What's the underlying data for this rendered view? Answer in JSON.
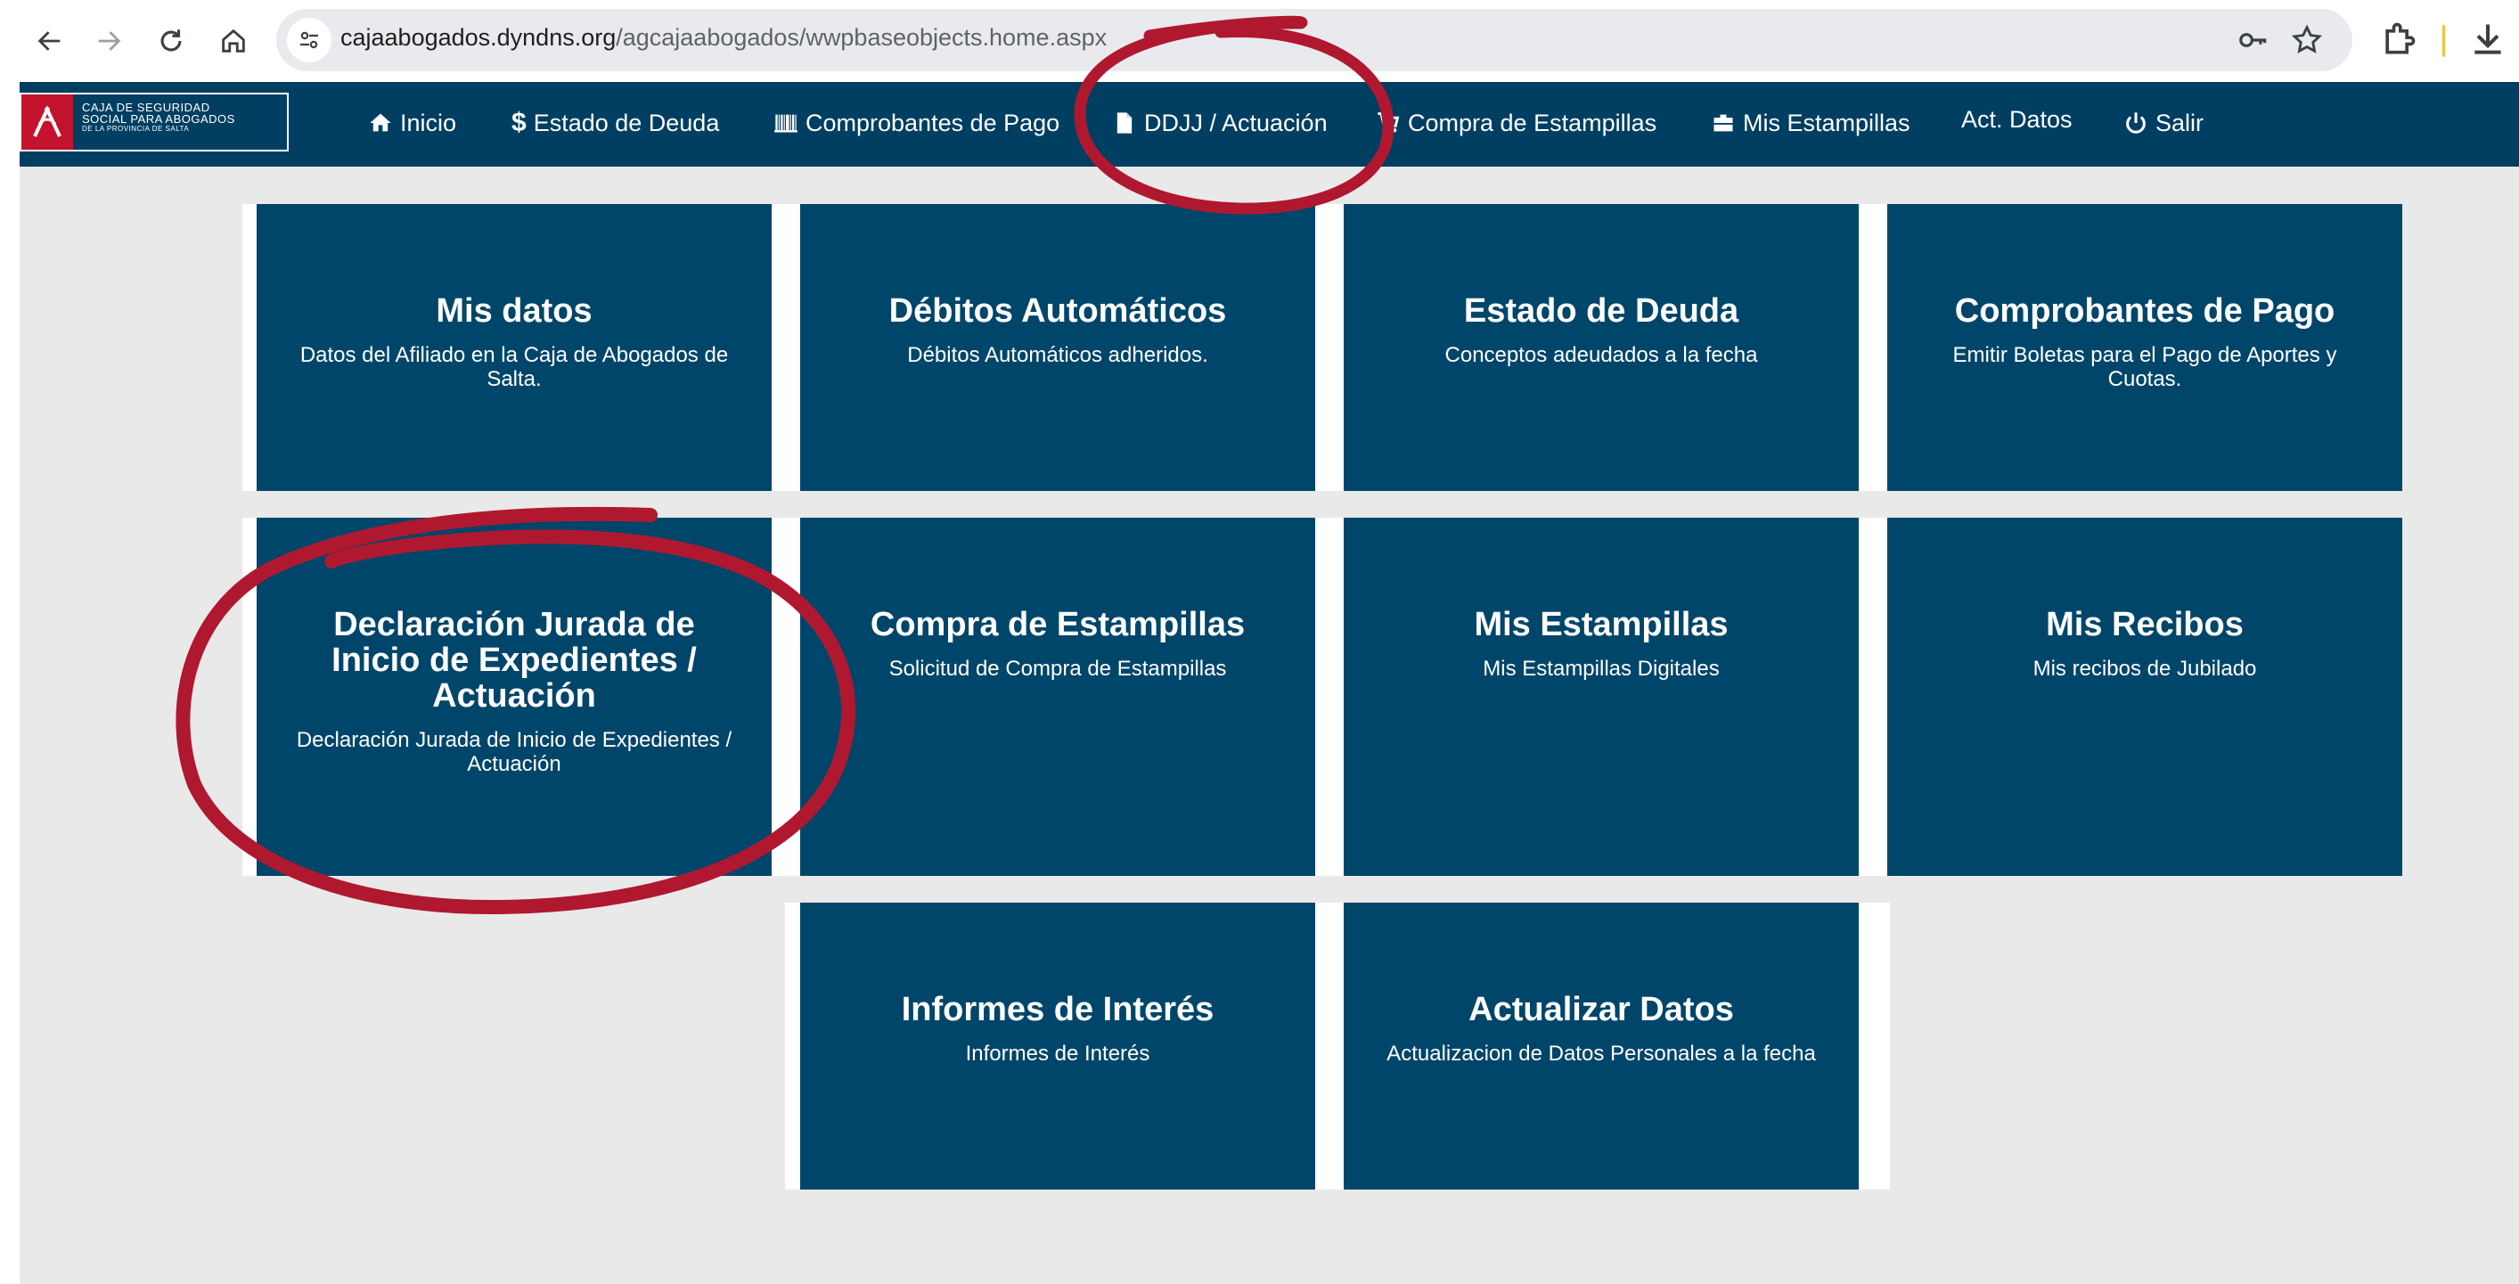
{
  "browser": {
    "url_host": "cajaabogados.dyndns.org",
    "url_path": "/agcajaabogados/wwpbaseobjects.home.aspx",
    "icons": [
      "back-icon",
      "forward-icon",
      "reload-icon",
      "home-icon",
      "site-info-icon",
      "password-key-icon",
      "bookmark-star-icon",
      "extensions-icon",
      "download-icon"
    ]
  },
  "logo": {
    "line1": "CAJA DE SEGURIDAD",
    "line2": "SOCIAL PARA ABOGADOS",
    "line3": "DE LA PROVINCIA DE SALTA"
  },
  "nav": {
    "inicio": "Inicio",
    "estado_deuda": "Estado de Deuda",
    "comprobantes": "Comprobantes de Pago",
    "ddjj": "DDJJ / Actuación",
    "compra_estampillas": "Compra de Estampillas",
    "mis_estampillas": "Mis Estampillas",
    "act_datos": "Act. Datos",
    "salir": "Salir"
  },
  "tiles": [
    {
      "title": "Mis datos",
      "desc": "Datos del Afiliado en la Caja de Abogados de Salta."
    },
    {
      "title": "Débitos Automáticos",
      "desc": "Débitos Automáticos adheridos."
    },
    {
      "title": "Estado de Deuda",
      "desc": "Conceptos adeudados a la fecha"
    },
    {
      "title": "Comprobantes de Pago",
      "desc": "Emitir Boletas para el Pago de Aportes y Cuotas."
    },
    {
      "title": "Declaración Jurada de Inicio de Expedientes / Actuación",
      "desc": "Declaración Jurada de Inicio de Expedientes / Actuación"
    },
    {
      "title": "Compra de Estampillas",
      "desc": "Solicitud de Compra de Estampillas"
    },
    {
      "title": "Mis Estampillas",
      "desc": "Mis Estampillas Digitales"
    },
    {
      "title": "Mis Recibos",
      "desc": "Mis recibos de Jubilado"
    },
    {
      "title": "Informes de Interés",
      "desc": "Informes de Interés"
    },
    {
      "title": "Actualizar Datos",
      "desc": "Actualizacion de Datos Personales a la fecha"
    }
  ],
  "colors": {
    "nav_bg": "#003f62",
    "tile_bg": "#00466a",
    "page_bg": "#e9e9e9",
    "annotation": "#b0182f",
    "logo_red": "#c4132e"
  }
}
